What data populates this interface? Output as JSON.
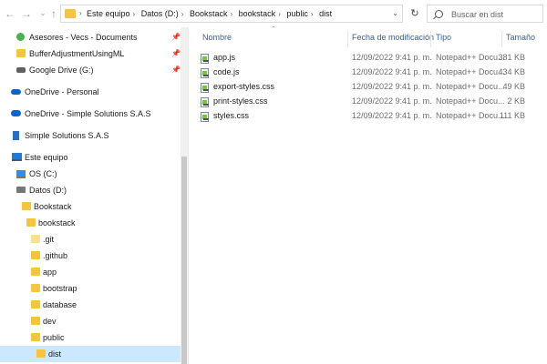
{
  "address": {
    "crumbs": [
      "Este equipo",
      "Datos (D:)",
      "Bookstack",
      "bookstack",
      "public",
      "dist"
    ],
    "separator": "›"
  },
  "search": {
    "placeholder": "Buscar en dist"
  },
  "nav": {
    "back": "←",
    "forward": "→",
    "recent": "⌄",
    "up": "↑",
    "refresh": "↻",
    "dropdown": "⌄"
  },
  "sidebar": {
    "items": [
      {
        "label": "Asesores - Vecs - Documents",
        "icon": "sharepoint-folder-icon",
        "pinned": true
      },
      {
        "label": "BufferAdjustmentUsingML",
        "icon": "folder-icon",
        "pinned": true
      },
      {
        "label": "Google Drive (G:)",
        "icon": "drive-icon",
        "pinned": true
      },
      {
        "label": "OneDrive - Personal",
        "icon": "onedrive-icon"
      },
      {
        "label": "OneDrive - Simple Solutions S.A.S",
        "icon": "onedrive-business-icon"
      },
      {
        "label": "Simple Solutions S.A.S",
        "icon": "building-icon"
      },
      {
        "label": "Este equipo",
        "icon": "this-pc-icon"
      },
      {
        "label": "OS (C:)",
        "icon": "windows-drive-icon"
      },
      {
        "label": "Datos (D:)",
        "icon": "hard-drive-icon"
      },
      {
        "label": "Bookstack",
        "icon": "folder-icon"
      },
      {
        "label": "bookstack",
        "icon": "folder-icon"
      },
      {
        "label": ".git",
        "icon": "folder-icon"
      },
      {
        "label": ".github",
        "icon": "folder-icon"
      },
      {
        "label": "app",
        "icon": "folder-icon"
      },
      {
        "label": "bootstrap",
        "icon": "folder-icon"
      },
      {
        "label": "database",
        "icon": "folder-icon"
      },
      {
        "label": "dev",
        "icon": "folder-icon"
      },
      {
        "label": "public",
        "icon": "folder-icon"
      },
      {
        "label": "dist",
        "icon": "folder-icon",
        "selected": true
      }
    ],
    "pin_glyph": "📌"
  },
  "columns": {
    "name": "Nombre",
    "date": "Fecha de modificación",
    "type": "Tipo",
    "size": "Tamaño"
  },
  "files": [
    {
      "name": "app.js",
      "date": "12/09/2022 9:41 p. m.",
      "type": "Notepad++ Docu...",
      "size": "381 KB"
    },
    {
      "name": "code.js",
      "date": "12/09/2022 9:41 p. m.",
      "type": "Notepad++ Docu...",
      "size": "434 KB"
    },
    {
      "name": "export-styles.css",
      "date": "12/09/2022 9:41 p. m.",
      "type": "Notepad++ Docu...",
      "size": "49 KB"
    },
    {
      "name": "print-styles.css",
      "date": "12/09/2022 9:41 p. m.",
      "type": "Notepad++ Docu...",
      "size": "2 KB"
    },
    {
      "name": "styles.css",
      "date": "12/09/2022 9:41 p. m.",
      "type": "Notepad++ Docu...",
      "size": "111 KB"
    }
  ],
  "sort_indicator": "⌃",
  "colors": {
    "selected_bg": "#cce8ff",
    "folder": "#f5c542",
    "header_text": "#3c5f8c"
  }
}
